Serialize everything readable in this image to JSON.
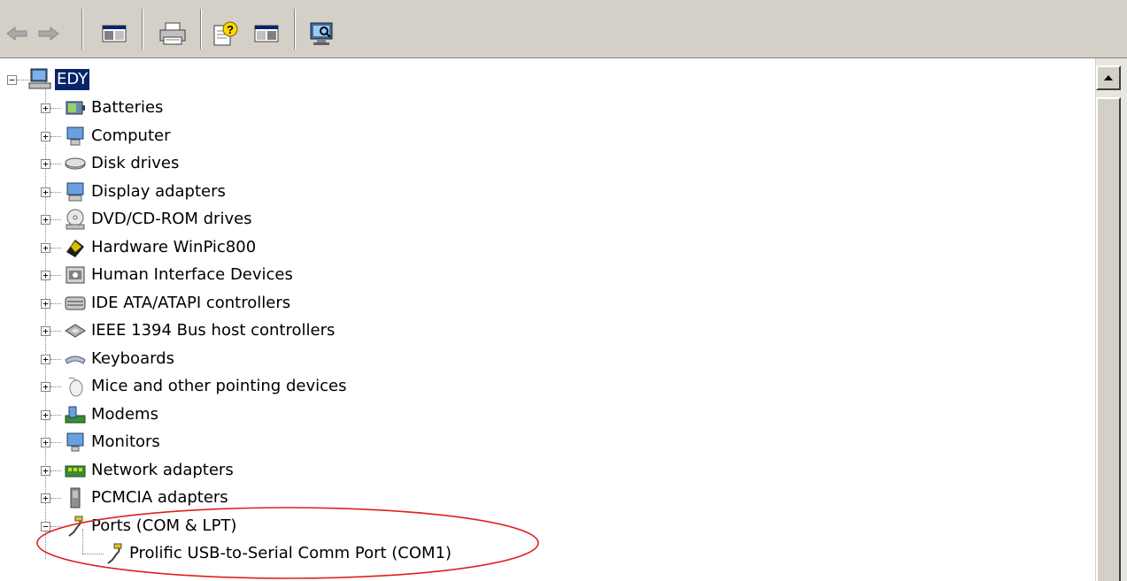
{
  "toolbar": {
    "buttons": [
      {
        "name": "back-button",
        "icon": "back-arrow-icon"
      },
      {
        "name": "forward-button",
        "icon": "forward-arrow-icon"
      },
      {
        "name": "show-hide-console-tree-button",
        "icon": "console-tree-icon"
      },
      {
        "name": "print-button",
        "icon": "printer-icon"
      },
      {
        "name": "help-button",
        "icon": "help-icon"
      },
      {
        "name": "show-hide-action-pane-button",
        "icon": "action-pane-icon"
      },
      {
        "name": "scan-hardware-changes-button",
        "icon": "scan-hardware-icon"
      }
    ]
  },
  "tree": {
    "root": {
      "label": "EDY",
      "icon": "computer-icon",
      "expanded": true,
      "selected": true
    },
    "items": [
      {
        "label": "Batteries",
        "icon": "battery-icon",
        "expanded": false
      },
      {
        "label": "Computer",
        "icon": "computer-device-icon",
        "expanded": false
      },
      {
        "label": "Disk drives",
        "icon": "disk-drive-icon",
        "expanded": false
      },
      {
        "label": "Display adapters",
        "icon": "display-adapter-icon",
        "expanded": false
      },
      {
        "label": "DVD/CD-ROM drives",
        "icon": "dvd-drive-icon",
        "expanded": false
      },
      {
        "label": "Hardware WinPic800",
        "icon": "hardware-icon",
        "expanded": false
      },
      {
        "label": "Human Interface Devices",
        "icon": "hid-icon",
        "expanded": false
      },
      {
        "label": "IDE ATA/ATAPI controllers",
        "icon": "ide-controller-icon",
        "expanded": false
      },
      {
        "label": "IEEE 1394 Bus host controllers",
        "icon": "ieee1394-icon",
        "expanded": false
      },
      {
        "label": "Keyboards",
        "icon": "keyboard-icon",
        "expanded": false
      },
      {
        "label": "Mice and other pointing devices",
        "icon": "mouse-icon",
        "expanded": false
      },
      {
        "label": "Modems",
        "icon": "modem-icon",
        "expanded": false
      },
      {
        "label": "Monitors",
        "icon": "monitor-icon",
        "expanded": false
      },
      {
        "label": "Network adapters",
        "icon": "network-adapter-icon",
        "expanded": false
      },
      {
        "label": "PCMCIA adapters",
        "icon": "pcmcia-icon",
        "expanded": false
      },
      {
        "label": "Ports (COM & LPT)",
        "icon": "port-connector-icon",
        "expanded": true,
        "children": [
          {
            "label": "Prolific USB-to-Serial Comm Port (COM1)",
            "icon": "port-connector-icon"
          }
        ]
      }
    ]
  },
  "annotation": {
    "shape": "ellipse",
    "color": "#e02020"
  },
  "colors": {
    "toolbar_bg": "#d4d0c8",
    "selection_bg": "#0a246a",
    "selection_text": "#ffffff"
  }
}
